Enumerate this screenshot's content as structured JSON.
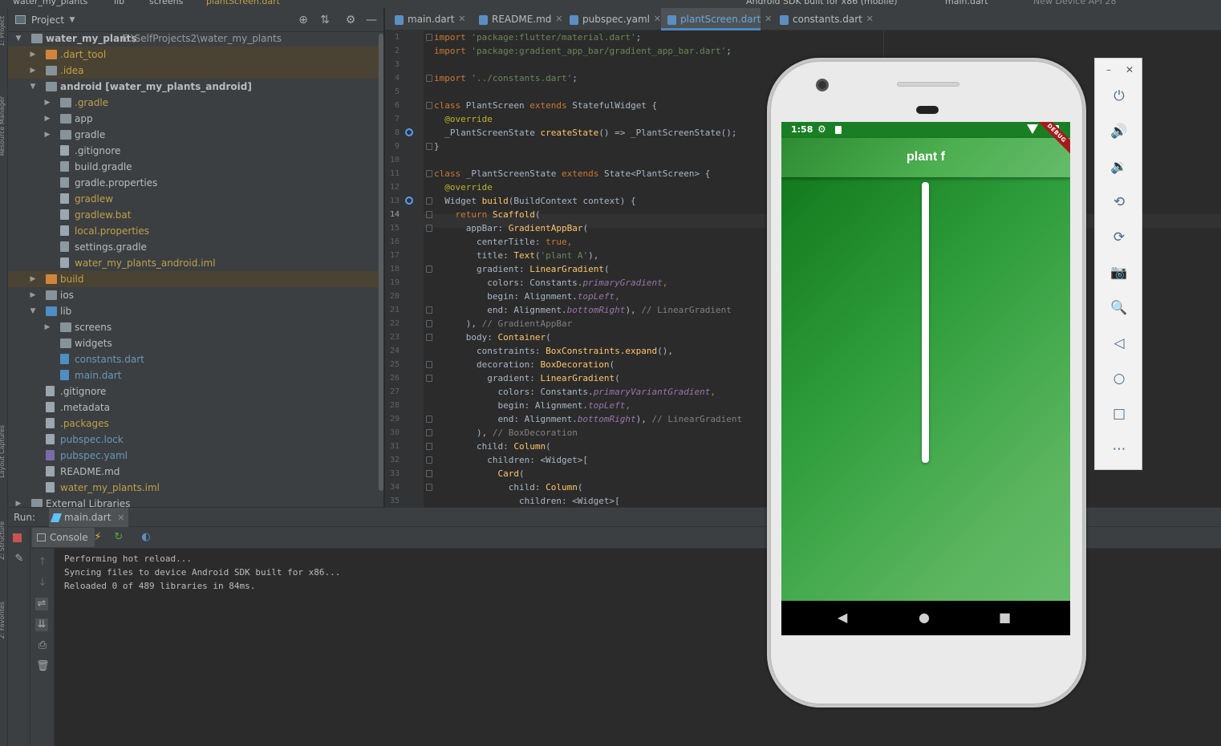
{
  "breadcrumb": {
    "project": "water_my_plants",
    "lib": "lib",
    "screens": "screens",
    "file": "plantScreen.dart",
    "device_selector": "Android SDK built for x86 (mobile)",
    "config_selector": "main.dart",
    "avd_selector": "New Device API 28"
  },
  "left_stripe": {
    "project_label": "1: Project",
    "resource_label": "Resource Manager",
    "layout_label": "Layout Captures",
    "structure_label": "Z: Structure",
    "favorites_label": "2: Favorites"
  },
  "project_panel": {
    "title": "Project",
    "tree": [
      {
        "label": "water_my_plants",
        "path": "E:\\SelfProjects2\\water_my_plants",
        "depth": 0,
        "arrow": "down",
        "icon": "folder",
        "color": "#bbbbbb",
        "bold": true
      },
      {
        "label": ".dart_tool",
        "depth": 1,
        "arrow": "right",
        "icon": "folder-orange",
        "color": "#bfa048",
        "excluded": true
      },
      {
        "label": ".idea",
        "depth": 1,
        "arrow": "right",
        "icon": "folder",
        "color": "#bfa048",
        "excluded": true
      },
      {
        "label": "android [water_my_plants_android]",
        "depth": 1,
        "arrow": "down",
        "icon": "folder",
        "color": "#bbbbbb",
        "bold": true
      },
      {
        "label": ".gradle",
        "depth": 2,
        "arrow": "right",
        "icon": "folder",
        "color": "#bfa048"
      },
      {
        "label": "app",
        "depth": 2,
        "arrow": "right",
        "icon": "folder",
        "color": "#bbbbbb"
      },
      {
        "label": "gradle",
        "depth": 2,
        "arrow": "right",
        "icon": "folder",
        "color": "#bbbbbb"
      },
      {
        "label": ".gitignore",
        "depth": 2,
        "arrow": "",
        "icon": "file",
        "color": "#bbbbbb"
      },
      {
        "label": "build.gradle",
        "depth": 2,
        "arrow": "",
        "icon": "gradle",
        "color": "#bbbbbb"
      },
      {
        "label": "gradle.properties",
        "depth": 2,
        "arrow": "",
        "icon": "gradle",
        "color": "#bbbbbb"
      },
      {
        "label": "gradlew",
        "depth": 2,
        "arrow": "",
        "icon": "file",
        "color": "#bfa048"
      },
      {
        "label": "gradlew.bat",
        "depth": 2,
        "arrow": "",
        "icon": "file",
        "color": "#bfa048"
      },
      {
        "label": "local.properties",
        "depth": 2,
        "arrow": "",
        "icon": "file",
        "color": "#bfa048"
      },
      {
        "label": "settings.gradle",
        "depth": 2,
        "arrow": "",
        "icon": "gradle",
        "color": "#bbbbbb"
      },
      {
        "label": "water_my_plants_android.iml",
        "depth": 2,
        "arrow": "",
        "icon": "file",
        "color": "#bfa048"
      },
      {
        "label": "build",
        "depth": 1,
        "arrow": "right",
        "icon": "folder-orange",
        "color": "#bfa048",
        "excluded": true
      },
      {
        "label": "ios",
        "depth": 1,
        "arrow": "right",
        "icon": "folder",
        "color": "#bbbbbb"
      },
      {
        "label": "lib",
        "depth": 1,
        "arrow": "down",
        "icon": "folder-blue",
        "color": "#bbbbbb"
      },
      {
        "label": "screens",
        "depth": 2,
        "arrow": "right",
        "icon": "folder",
        "color": "#bbbbbb"
      },
      {
        "label": "widgets",
        "depth": 2,
        "arrow": "",
        "icon": "folder",
        "color": "#bbbbbb"
      },
      {
        "label": "constants.dart",
        "depth": 2,
        "arrow": "",
        "icon": "dart",
        "color": "#6897bb"
      },
      {
        "label": "main.dart",
        "depth": 2,
        "arrow": "",
        "icon": "dart",
        "color": "#6897bb"
      },
      {
        "label": ".gitignore",
        "depth": 1,
        "arrow": "",
        "icon": "file",
        "color": "#bbbbbb"
      },
      {
        "label": ".metadata",
        "depth": 1,
        "arrow": "",
        "icon": "file",
        "color": "#bbbbbb"
      },
      {
        "label": ".packages",
        "depth": 1,
        "arrow": "",
        "icon": "file",
        "color": "#bfa048"
      },
      {
        "label": "pubspec.lock",
        "depth": 1,
        "arrow": "",
        "icon": "file",
        "color": "#6897bb"
      },
      {
        "label": "pubspec.yaml",
        "depth": 1,
        "arrow": "",
        "icon": "yaml",
        "color": "#6897bb"
      },
      {
        "label": "README.md",
        "depth": 1,
        "arrow": "",
        "icon": "file",
        "color": "#bbbbbb"
      },
      {
        "label": "water_my_plants.iml",
        "depth": 1,
        "arrow": "",
        "icon": "file",
        "color": "#bfa048"
      },
      {
        "label": "External Libraries",
        "depth": 0,
        "arrow": "right",
        "icon": "lib",
        "color": "#bbbbbb"
      }
    ]
  },
  "editor": {
    "tabs": [
      {
        "label": "main.dart",
        "active": false
      },
      {
        "label": "README.md",
        "active": false
      },
      {
        "label": "pubspec.yaml",
        "active": false
      },
      {
        "label": "plantScreen.dart",
        "active": true
      },
      {
        "label": "constants.dart",
        "active": false
      }
    ],
    "current_line": 14,
    "lines": [
      [
        [
          "kw",
          "import "
        ],
        [
          "str",
          "'package:flutter/material.dart'"
        ],
        [
          "",
          "; "
        ]
      ],
      [
        [
          "kw",
          "import "
        ],
        [
          "str",
          "'package:gradient_app_bar/gradient_app_bar.dart'"
        ],
        [
          "",
          ";"
        ]
      ],
      [],
      [
        [
          "kw",
          "import "
        ],
        [
          "str",
          "'../constants.dart'"
        ],
        [
          "",
          ";"
        ]
      ],
      [],
      [
        [
          "kw",
          "class "
        ],
        [
          "",
          "PlantScreen "
        ],
        [
          "kw",
          "extends "
        ],
        [
          "",
          "StatefulWidget {"
        ]
      ],
      [
        [
          "an",
          "  @override"
        ]
      ],
      [
        [
          "",
          "  _PlantScreenState "
        ],
        [
          "fn",
          "createState"
        ],
        [
          "",
          "() => _PlantScreenState();"
        ]
      ],
      [
        [
          "",
          "}"
        ]
      ],
      [],
      [
        [
          "kw",
          "class "
        ],
        [
          "",
          "_PlantScreenState "
        ],
        [
          "kw",
          "extends "
        ],
        [
          "",
          "State<PlantScreen> {"
        ]
      ],
      [
        [
          "an",
          "  @override"
        ]
      ],
      [
        [
          "",
          "  Widget "
        ],
        [
          "fn",
          "build"
        ],
        [
          "",
          "(BuildContext context) {"
        ]
      ],
      [
        [
          "kw",
          "    return "
        ],
        [
          "fn",
          "Scaffold"
        ],
        [
          "",
          "("
        ]
      ],
      [
        [
          "",
          "      appBar: "
        ],
        [
          "fn",
          "GradientAppBar"
        ],
        [
          "",
          "("
        ]
      ],
      [
        [
          "",
          "        centerTitle: "
        ],
        [
          "kw",
          "true"
        ],
        [
          "kw",
          ","
        ]
      ],
      [
        [
          "",
          "        title: "
        ],
        [
          "fn",
          "Text"
        ],
        [
          "",
          "("
        ],
        [
          "str",
          "'plant A'"
        ],
        [
          "",
          "),"
        ]
      ],
      [
        [
          "",
          "        gradient: "
        ],
        [
          "fn",
          "LinearGradient"
        ],
        [
          "",
          "("
        ]
      ],
      [
        [
          "",
          "          colors: Constants."
        ],
        [
          "it",
          "primaryGradient"
        ],
        [
          "kw",
          ","
        ]
      ],
      [
        [
          "",
          "          begin: Alignment."
        ],
        [
          "it",
          "topLeft"
        ],
        [
          "kw",
          ","
        ]
      ],
      [
        [
          "",
          "          end: Alignment."
        ],
        [
          "it",
          "bottomRight"
        ],
        [
          "",
          "), "
        ],
        [
          "cm",
          "// LinearGradient"
        ]
      ],
      [
        [
          "",
          "      ), "
        ],
        [
          "cm",
          "// GradientAppBar"
        ]
      ],
      [
        [
          "",
          "      body: "
        ],
        [
          "fn",
          "Container"
        ],
        [
          "",
          "("
        ]
      ],
      [
        [
          "",
          "        constraints: "
        ],
        [
          "fn",
          "BoxConstraints.expand"
        ],
        [
          "",
          "(),"
        ]
      ],
      [
        [
          "",
          "        decoration: "
        ],
        [
          "fn",
          "BoxDecoration"
        ],
        [
          "",
          "("
        ]
      ],
      [
        [
          "",
          "          gradient: "
        ],
        [
          "fn",
          "LinearGradient"
        ],
        [
          "",
          "("
        ]
      ],
      [
        [
          "",
          "            colors: Constants."
        ],
        [
          "it",
          "primaryVariantGradient"
        ],
        [
          "kw",
          ","
        ]
      ],
      [
        [
          "",
          "            begin: Alignment."
        ],
        [
          "it",
          "topLeft"
        ],
        [
          "kw",
          ","
        ]
      ],
      [
        [
          "",
          "            end: Alignment."
        ],
        [
          "it",
          "bottomRight"
        ],
        [
          "",
          "), "
        ],
        [
          "cm",
          "// LinearGradient"
        ]
      ],
      [
        [
          "",
          "        ), "
        ],
        [
          "cm",
          "// BoxDecoration"
        ]
      ],
      [
        [
          "",
          "        child: "
        ],
        [
          "fn",
          "Column"
        ],
        [
          "",
          "("
        ]
      ],
      [
        [
          "",
          "          children: <Widget>["
        ]
      ],
      [
        [
          "",
          "            "
        ],
        [
          "fn",
          "Card"
        ],
        [
          "",
          "("
        ]
      ],
      [
        [
          "",
          "              child: "
        ],
        [
          "fn",
          "Column"
        ],
        [
          "",
          "("
        ]
      ],
      [
        [
          "",
          "                children: <Widget>["
        ]
      ]
    ]
  },
  "run_panel": {
    "label": "Run:",
    "config_tab": "main.dart",
    "console_tab": "Console",
    "output": [
      "Performing hot reload...",
      "Syncing files to device Android SDK built for x86...",
      "Reloaded 0 of 489 libraries in 84ms."
    ]
  },
  "emulator": {
    "status_time": "1:58",
    "debug_banner": "DEBUG",
    "app_title": "plant f",
    "appbar_gradient": [
      "#2e8b32",
      "#66bb6a"
    ],
    "body_gradient": [
      "#137a1d",
      "#66bb6a"
    ],
    "controls": [
      "power-icon",
      "volume-up-icon",
      "volume-down-icon",
      "rotate-left-icon",
      "rotate-right-icon",
      "camera-icon",
      "zoom-icon",
      "back-icon",
      "home-icon",
      "overview-icon",
      "more-icon"
    ]
  }
}
